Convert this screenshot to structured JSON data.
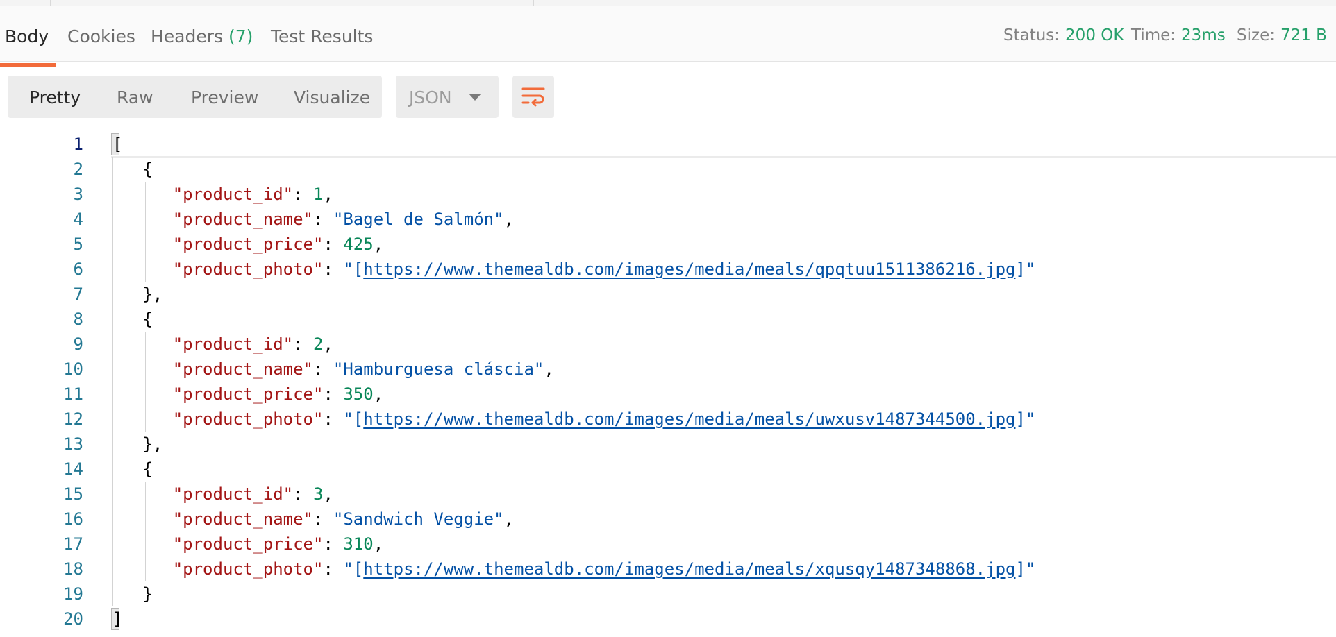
{
  "response_tabs": [
    {
      "label": "Body",
      "active": true
    },
    {
      "label": "Cookies",
      "active": false
    },
    {
      "label": "Headers",
      "count": "(7)",
      "active": false
    },
    {
      "label": "Test Results",
      "active": false
    }
  ],
  "status_bar": {
    "status_label": "Status:",
    "status_value": "200 OK",
    "time_label": "Time:",
    "time_value": "23ms",
    "size_label": "Size:",
    "size_value": "721 B"
  },
  "view_modes": [
    {
      "label": "Pretty",
      "active": true
    },
    {
      "label": "Raw",
      "active": false
    },
    {
      "label": "Preview",
      "active": false
    },
    {
      "label": "Visualize",
      "active": false
    }
  ],
  "format_select": {
    "value": "JSON",
    "icon": "chevron-down-icon"
  },
  "wrap_button": {
    "icon": "wrap-lines-icon",
    "color": "#f26b3a"
  },
  "colors": {
    "accent": "#f26b3a",
    "success": "#26a06a",
    "json_key": "#a31515",
    "json_string": "#0451a5",
    "json_number": "#098658",
    "line_number": "#237893"
  },
  "code_lines": [
    {
      "n": "1",
      "text": "["
    },
    {
      "n": "2",
      "text": "{"
    },
    {
      "n": "3",
      "key": "\"product_id\"",
      "val": "1",
      "kind": "num",
      "trail": ","
    },
    {
      "n": "4",
      "key": "\"product_name\"",
      "val": "\"Bagel de Salmón\"",
      "kind": "str",
      "trail": ","
    },
    {
      "n": "5",
      "key": "\"product_price\"",
      "val": "425",
      "kind": "num",
      "trail": ","
    },
    {
      "n": "6",
      "key": "\"product_photo\"",
      "pre": "\"[",
      "link": "https://www.themealdb.com/images/media/meals/qpqtuu1511386216.jpg",
      "post": "]\"",
      "kind": "link"
    },
    {
      "n": "7",
      "text": "},"
    },
    {
      "n": "8",
      "text": "{"
    },
    {
      "n": "9",
      "key": "\"product_id\"",
      "val": "2",
      "kind": "num",
      "trail": ","
    },
    {
      "n": "10",
      "key": "\"product_name\"",
      "val": "\"Hamburguesa cláscia\"",
      "kind": "str",
      "trail": ","
    },
    {
      "n": "11",
      "key": "\"product_price\"",
      "val": "350",
      "kind": "num",
      "trail": ","
    },
    {
      "n": "12",
      "key": "\"product_photo\"",
      "pre": "\"[",
      "link": "https://www.themealdb.com/images/media/meals/uwxusv1487344500.jpg",
      "post": "]\"",
      "kind": "link"
    },
    {
      "n": "13",
      "text": "},"
    },
    {
      "n": "14",
      "text": "{"
    },
    {
      "n": "15",
      "key": "\"product_id\"",
      "val": "3",
      "kind": "num",
      "trail": ","
    },
    {
      "n": "16",
      "key": "\"product_name\"",
      "val": "\"Sandwich Veggie\"",
      "kind": "str",
      "trail": ","
    },
    {
      "n": "17",
      "key": "\"product_price\"",
      "val": "310",
      "kind": "num",
      "trail": ","
    },
    {
      "n": "18",
      "key": "\"product_photo\"",
      "pre": "\"[",
      "link": "https://www.themealdb.com/images/media/meals/xqusqy1487348868.jpg",
      "post": "]\"",
      "kind": "link"
    },
    {
      "n": "19",
      "text": "}"
    },
    {
      "n": "20",
      "text": "]"
    }
  ]
}
